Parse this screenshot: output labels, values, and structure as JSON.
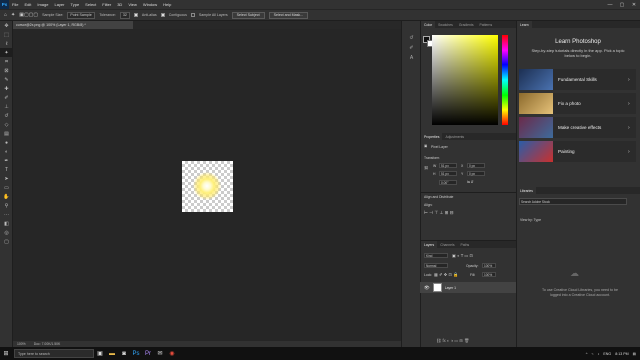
{
  "app": {
    "logo": "Ps"
  },
  "menu": [
    "File",
    "Edit",
    "Image",
    "Layer",
    "Type",
    "Select",
    "Filter",
    "3D",
    "View",
    "Window",
    "Help"
  ],
  "options": {
    "sample_size_label": "Sample Size:",
    "sample_size_value": "Point Sample",
    "tolerance_label": "Tolerance:",
    "tolerance_value": "32",
    "anti_alias": "Anti-alias",
    "contiguous": "Contiguous",
    "sample_all": "Sample All Layers",
    "select_subject": "Select Subject",
    "select_mask": "Select and Mask..."
  },
  "document": {
    "tab": "cursor@2x.png @ 100% (Layer 1, RGB/8) *",
    "zoom": "100%",
    "info": "Doc: 7.00K/1.50K"
  },
  "color_panel": {
    "tabs": [
      "Color",
      "Swatches",
      "Gradients",
      "Patterns"
    ]
  },
  "properties_panel": {
    "tabs": [
      "Properties",
      "Adjustments"
    ],
    "pixel_layer": "Pixel Layer",
    "transform": "Transform",
    "w_label": "W",
    "w_value": "51 px",
    "h_label": "H",
    "h_value": "51 px",
    "x_label": "X",
    "x_value": "0 px",
    "y_label": "Y",
    "y_value": "0 px",
    "angle_value": "0.00°",
    "align": "Align and Distribute",
    "align_label": "Align:"
  },
  "layers_panel": {
    "tabs": [
      "Layers",
      "Channels",
      "Paths"
    ],
    "kind": "Kind",
    "blend": "Normal",
    "opacity_label": "Opacity:",
    "opacity_value": "100%",
    "lock_label": "Lock:",
    "fill_label": "Fill:",
    "fill_value": "100%",
    "layer_name": "Layer 1"
  },
  "learn_panel": {
    "tab": "Learn",
    "title": "Learn Photoshop",
    "subtitle": "Step-by-step tutorials directly in the app. Pick a topic below to begin.",
    "cards": [
      {
        "label": "Fundamental Skills",
        "color": "#2d4a7a"
      },
      {
        "label": "Fix a photo",
        "color": "#d9a441"
      },
      {
        "label": "Make creative effects",
        "color": "#3d6b9c"
      },
      {
        "label": "Painting",
        "color": "#c8302e"
      }
    ]
  },
  "libraries_panel": {
    "tab": "Libraries",
    "search_placeholder": "Search Adobe Stock",
    "view_by": "View by: Type",
    "message": "To use Creative Cloud Libraries, you need to be logged into a Creative Cloud account."
  },
  "taskbar": {
    "search": "Type here to search",
    "lang": "ENG",
    "time": "8:13 PM"
  }
}
